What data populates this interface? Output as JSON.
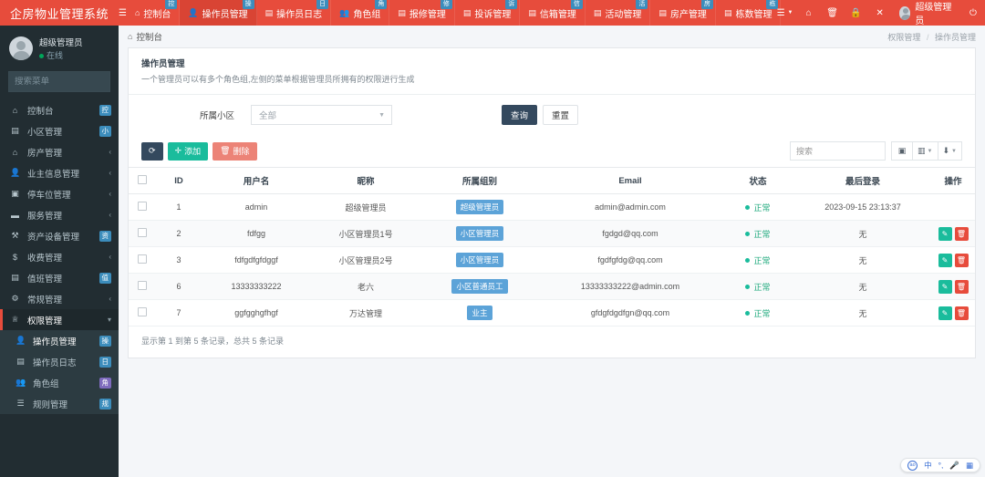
{
  "brand": {
    "title": "企房物业管理系统"
  },
  "topnav": {
    "hamburger_icon": "bars-icon",
    "items": [
      {
        "label": "控制台",
        "icon": "dashboard-icon",
        "badge": "控",
        "active": false
      },
      {
        "label": "操作员管理",
        "icon": "user-icon",
        "badge": "操",
        "active": true
      },
      {
        "label": "操作员日志",
        "icon": "list-icon",
        "badge": "日",
        "active": false
      },
      {
        "label": "角色组",
        "icon": "users-icon",
        "badge": "角",
        "active": false
      },
      {
        "label": "报修管理",
        "icon": "list-icon",
        "badge": "修",
        "active": false
      },
      {
        "label": "投诉管理",
        "icon": "list-icon",
        "badge": "诉",
        "active": false
      },
      {
        "label": "信箱管理",
        "icon": "list-icon",
        "badge": "信",
        "active": false
      },
      {
        "label": "活动管理",
        "icon": "list-icon",
        "badge": "活",
        "active": false
      },
      {
        "label": "房产管理",
        "icon": "list-icon",
        "badge": "房",
        "active": false
      },
      {
        "label": "栋数管理",
        "icon": "list-icon",
        "badge": "栋",
        "active": false
      }
    ],
    "right_icons": [
      {
        "name": "menu-toggle-icon",
        "glyph": "☰"
      },
      {
        "name": "home-icon",
        "glyph": "⌂"
      },
      {
        "name": "trash-icon",
        "glyph": "🗑"
      },
      {
        "name": "lock-icon",
        "glyph": "🔒"
      },
      {
        "name": "fullscreen-icon",
        "glyph": "✕"
      }
    ],
    "user_label": "超级管理员",
    "logout_icon": "power-icon"
  },
  "sidebar": {
    "profile": {
      "name": "超级管理员",
      "status": "在线"
    },
    "search": {
      "placeholder": "搜索菜单",
      "icon": "search-icon"
    },
    "items": [
      {
        "label": "控制台",
        "icon": "dashboard-icon",
        "badge": "控",
        "badge_color": "blue",
        "caret": false,
        "active": false
      },
      {
        "label": "小区管理",
        "icon": "building-icon",
        "badge": "小",
        "badge_color": "blue",
        "caret": false,
        "active": false
      },
      {
        "label": "房产管理",
        "icon": "home-icon",
        "badge": "",
        "badge_color": "",
        "caret": true,
        "active": false
      },
      {
        "label": "业主信息管理",
        "icon": "user-icon",
        "badge": "",
        "badge_color": "",
        "caret": true,
        "active": false
      },
      {
        "label": "停车位管理",
        "icon": "car-icon",
        "badge": "",
        "badge_color": "",
        "caret": true,
        "active": false
      },
      {
        "label": "服务管理",
        "icon": "service-icon",
        "badge": "",
        "badge_color": "",
        "caret": true,
        "active": false
      },
      {
        "label": "资产设备管理",
        "icon": "tools-icon",
        "badge": "资",
        "badge_color": "blue",
        "caret": false,
        "active": false
      },
      {
        "label": "收费管理",
        "icon": "money-icon",
        "badge": "",
        "badge_color": "",
        "caret": true,
        "active": false
      },
      {
        "label": "值班管理",
        "icon": "calendar-icon",
        "badge": "值",
        "badge_color": "blue",
        "caret": false,
        "active": false
      },
      {
        "label": "常规管理",
        "icon": "cogs-icon",
        "badge": "",
        "badge_color": "",
        "caret": true,
        "active": false
      },
      {
        "label": "权限管理",
        "icon": "shield-icon",
        "badge": "",
        "badge_color": "",
        "caret": true,
        "active": true
      }
    ],
    "submenu": [
      {
        "label": "操作员管理",
        "icon": "user-icon",
        "badge": "操",
        "badge_color": "blue",
        "active": true
      },
      {
        "label": "操作员日志",
        "icon": "list-icon",
        "badge": "日",
        "badge_color": "blue",
        "active": false
      },
      {
        "label": "角色组",
        "icon": "users-icon",
        "badge": "角",
        "badge_color": "purple",
        "active": false
      },
      {
        "label": "规则管理",
        "icon": "rules-icon",
        "badge": "规",
        "badge_color": "blue",
        "active": false
      }
    ]
  },
  "breadcrumb": {
    "icon": "dashboard-icon",
    "current": "控制台",
    "right_parent": "权限管理",
    "right_separator": "/",
    "right_child": "操作员管理"
  },
  "panel": {
    "title": "操作员管理",
    "subtitle": "一个管理员可以有多个角色组,左侧的菜单根据管理员所拥有的权限进行生成"
  },
  "filters": {
    "community_label": "所属小区",
    "community_value": "全部",
    "chevron_icon": "chevron-down-icon",
    "query_label": "查询",
    "reset_label": "重置"
  },
  "toolbar": {
    "refresh_icon": "refresh-icon",
    "refresh_label": "",
    "add_icon": "plus-icon",
    "add_label": "添加",
    "delete_icon": "trash-icon",
    "delete_label": "删除",
    "search_placeholder": "搜索",
    "search_value": "",
    "icons": [
      {
        "name": "fullscreen-table-icon",
        "glyph": "▣",
        "caret": false
      },
      {
        "name": "columns-icon",
        "glyph": "▥",
        "caret": true
      },
      {
        "name": "export-icon",
        "glyph": "⬇",
        "caret": true
      }
    ]
  },
  "table": {
    "columns": [
      "",
      "ID",
      "用户名",
      "昵称",
      "所属组别",
      "Email",
      "状态",
      "最后登录",
      "操作"
    ],
    "rows": [
      {
        "id": "1",
        "username": "admin",
        "nickname": "超级管理员",
        "group": "超级管理员",
        "email": "admin@admin.com",
        "status": "正常",
        "last_login": "2023-09-15 23:13:37",
        "has_ops": false
      },
      {
        "id": "2",
        "username": "fdfgg",
        "nickname": "小区管理员1号",
        "group": "小区管理员",
        "email": "fgdgd@qq.com",
        "status": "正常",
        "last_login": "无",
        "has_ops": true
      },
      {
        "id": "3",
        "username": "fdfgdfgfdggf",
        "nickname": "小区管理员2号",
        "group": "小区管理员",
        "email": "fgdfgfdg@qq.com",
        "status": "正常",
        "last_login": "无",
        "has_ops": true
      },
      {
        "id": "6",
        "username": "13333333222",
        "nickname": "老六",
        "group": "小区普通员工",
        "email": "13333333222@admin.com",
        "status": "正常",
        "last_login": "无",
        "has_ops": true
      },
      {
        "id": "7",
        "username": "ggfgghgfhgf",
        "nickname": "万达管理",
        "group": "业主",
        "email": "gfdgfdgdfgn@qq.com",
        "status": "正常",
        "last_login": "无",
        "has_ops": true
      }
    ],
    "ops": {
      "edit_icon": "pencil-icon",
      "delete_icon": "trash-icon"
    },
    "footer": "显示第 1 到第 5 条记录，总共 5 条记录"
  },
  "ime": {
    "items": [
      "中",
      "°,",
      "🎤",
      "▦"
    ],
    "logo": "ime-logo-icon"
  },
  "colors": {
    "nav_red": "#e74c3c",
    "sidebar_dark": "#222d32",
    "badge_blue": "#3c8dbc",
    "success_green": "#1abc9c",
    "danger_red": "#e74c3c"
  }
}
